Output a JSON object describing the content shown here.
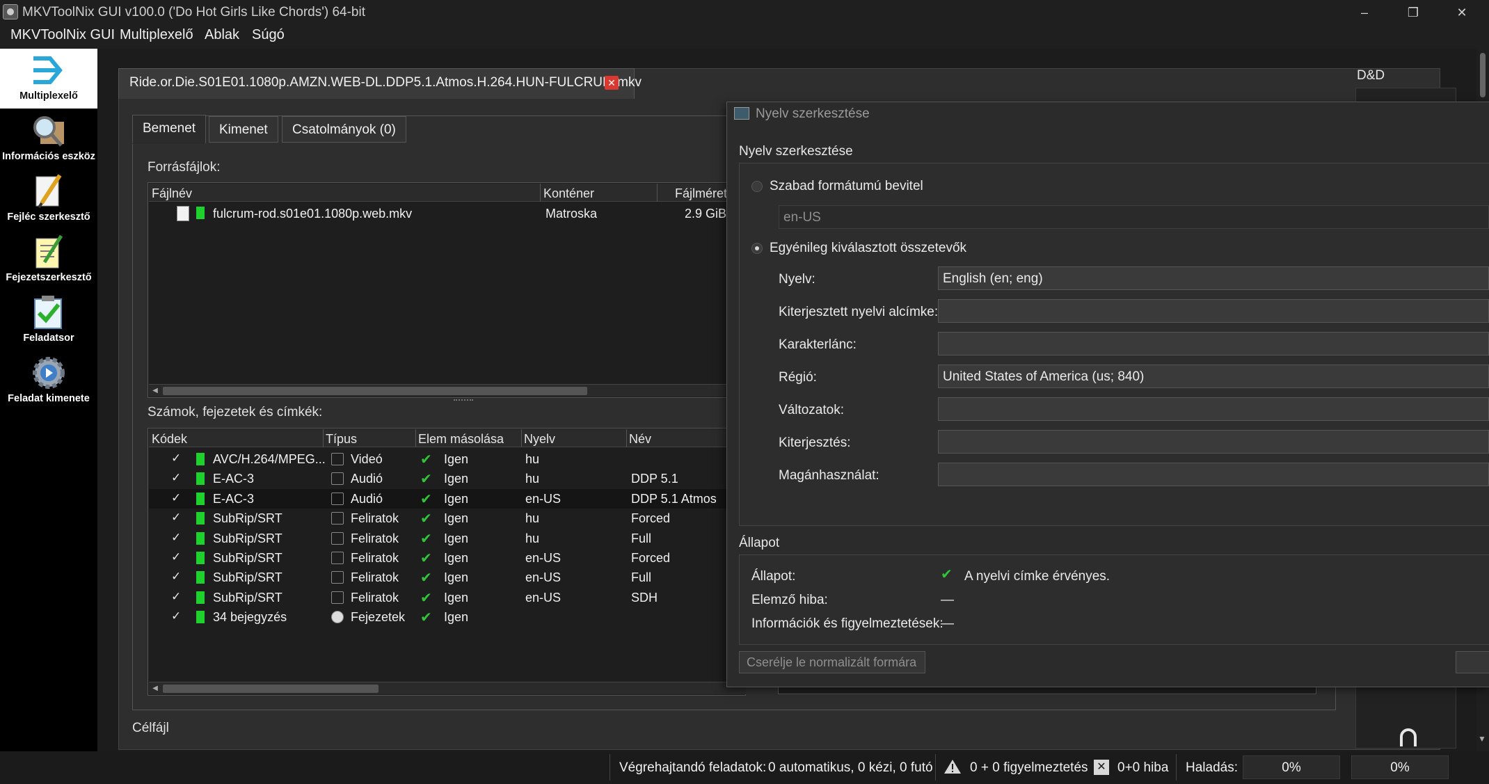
{
  "window": {
    "title": "MKVToolNix GUI v100.0 ('Do Hot Girls Like Chords') 64-bit",
    "minimize": "–",
    "maximize": "❐",
    "close": "✕"
  },
  "menu": [
    "MKVToolNix GUI",
    "Multiplexelő",
    "Ablak",
    "Súgó"
  ],
  "sidebar": [
    {
      "label": "Multiplexelő",
      "icon": "multiplexer-icon"
    },
    {
      "label": "Információs eszköz",
      "icon": "info-tool-icon"
    },
    {
      "label": "Fejléc szerkesztő",
      "icon": "header-editor-icon"
    },
    {
      "label": "Fejezetszerkesztő",
      "icon": "chapter-editor-icon"
    },
    {
      "label": "Feladatsor",
      "icon": "job-queue-icon"
    },
    {
      "label": "Feladat kimenete",
      "icon": "job-output-icon"
    }
  ],
  "file_tab": {
    "label": "Ride.or.Die.S01E01.1080p.AMZN.WEB-DL.DDP5.1.Atmos.H.264.HUN-FULCRUM.mkv",
    "close": "✕"
  },
  "subtabs": [
    "Bemenet",
    "Kimenet",
    "Csatolmányok (0)"
  ],
  "source_files": {
    "label": "Forrásfájlok:",
    "columns": [
      "Fájlnév",
      "Konténer",
      "Fájlméret"
    ],
    "rows": [
      {
        "name": "fulcrum-rod.s01e01.1080p.web.mkv",
        "container": "Matroska",
        "size": "2.9 GiB"
      }
    ]
  },
  "tracks": {
    "label": "Számok, fejezetek és címkék:",
    "columns": [
      "Kódek",
      "Típus",
      "Elem másolása",
      "Nyelv",
      "Név"
    ],
    "rows": [
      {
        "check": "✓",
        "codec": "AVC/H.264/MPEG...",
        "type": "Videó",
        "copy": "Igen",
        "lang": "hu",
        "name": ""
      },
      {
        "check": "✓",
        "codec": "E-AC-3",
        "type": "Audió",
        "copy": "Igen",
        "lang": "hu",
        "name": "DDP 5.1"
      },
      {
        "check": "✓",
        "codec": "E-AC-3",
        "type": "Audió",
        "copy": "Igen",
        "lang": "en-US",
        "name": "DDP 5.1 Atmos"
      },
      {
        "check": "✓",
        "codec": "SubRip/SRT",
        "type": "Feliratok",
        "copy": "Igen",
        "lang": "hu",
        "name": "Forced"
      },
      {
        "check": "✓",
        "codec": "SubRip/SRT",
        "type": "Feliratok",
        "copy": "Igen",
        "lang": "hu",
        "name": "Full"
      },
      {
        "check": "✓",
        "codec": "SubRip/SRT",
        "type": "Feliratok",
        "copy": "Igen",
        "lang": "en-US",
        "name": "Forced"
      },
      {
        "check": "✓",
        "codec": "SubRip/SRT",
        "type": "Feliratok",
        "copy": "Igen",
        "lang": "en-US",
        "name": "Full"
      },
      {
        "check": "✓",
        "codec": "SubRip/SRT",
        "type": "Feliratok",
        "copy": "Igen",
        "lang": "en-US",
        "name": "SDH"
      },
      {
        "check": "✓",
        "codec": "34 bejegyzés",
        "type": "Fejezetek",
        "copy": "Igen",
        "lang": "",
        "name": ""
      }
    ]
  },
  "output_file_label": "Célfájl",
  "right_dock": {
    "label": "D&D"
  },
  "dialog": {
    "title": "Nyelv szerkesztése",
    "group_label": "Nyelv szerkesztése",
    "free_form_label": "Szabad formátumú bevitel",
    "free_form_value": "en-US",
    "components_label": "Egyénileg kiválasztott összetevők",
    "fields": [
      {
        "label": "Nyelv:",
        "value": "English (en; eng)"
      },
      {
        "label": "Kiterjesztett nyelvi alcímke:",
        "value": ""
      },
      {
        "label": "Karakterlánc:",
        "value": ""
      },
      {
        "label": "Régió:",
        "value": "United States of America (us; 840)"
      },
      {
        "label": "Változatok:",
        "value": ""
      },
      {
        "label": "Kiterjesztés:",
        "value": ""
      },
      {
        "label": "Magánhasználat:",
        "value": ""
      }
    ],
    "status_group_label": "Állapot",
    "status": [
      {
        "label": "Állapot:",
        "value": "A nyelvi címke érvényes."
      },
      {
        "label": "Elemző hiba:",
        "value": "—"
      },
      {
        "label": "Információk és figyelmeztetések:",
        "value": "—"
      }
    ],
    "normalize_button": "Cserélje le normalizált formára"
  },
  "statusbar": {
    "jobs": "Végrehajtandó feladatok:",
    "jobs_value": "0 automatikus, 0 kézi, 0 futó",
    "warnings": "0 + 0 figyelmeztetés",
    "errors": "0+0 hiba",
    "progress_label": "Haladás:",
    "progress1": "0%",
    "progress2": "0%"
  }
}
